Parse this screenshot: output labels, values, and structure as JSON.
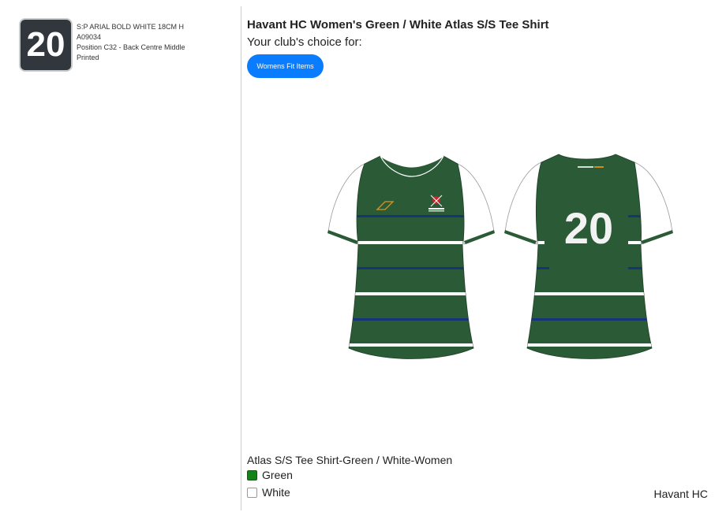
{
  "print_spec": {
    "number": "20",
    "lines": [
      "S:P ARIAL BOLD WHITE 18CM H",
      "A09034",
      "Position C32 - Back Centre Middle",
      "Printed"
    ]
  },
  "product": {
    "title": "Havant HC Women's Green / White Atlas S/S Tee Shirt",
    "subtitle": "Your club's choice for:",
    "choice_button": "Womens Fit Items",
    "back_number": "20"
  },
  "variant": {
    "name": "Atlas S/S Tee Shirt-Green / White-Women",
    "options": [
      {
        "label": "Green",
        "color": "#15821a"
      },
      {
        "label": "White",
        "color": "#ffffff"
      }
    ]
  },
  "club_name": "Havant HC",
  "colors": {
    "shirt_green": "#2a5a36",
    "stripe_navy": "#173478",
    "accent_blue": "#0a7cff",
    "badge_dark": "#31373d"
  }
}
